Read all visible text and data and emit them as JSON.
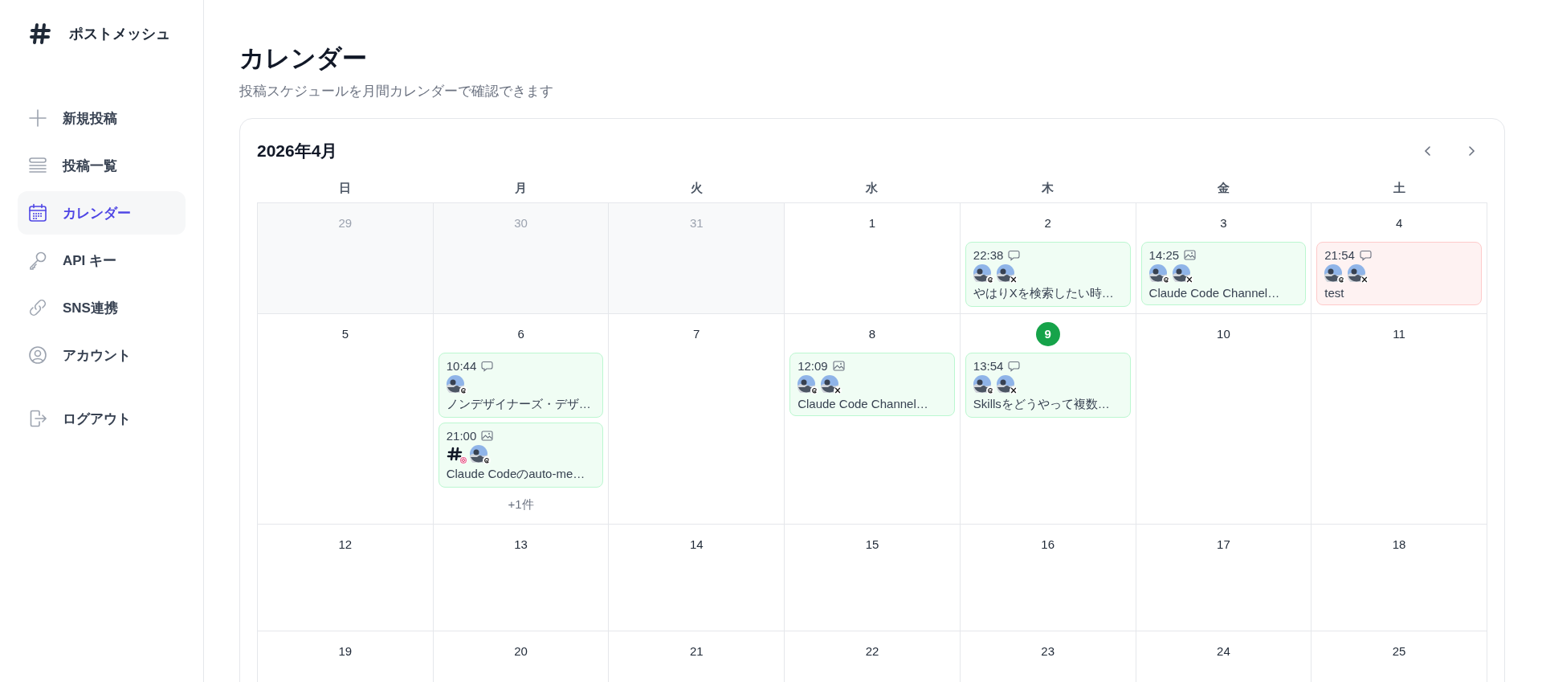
{
  "sidebar": {
    "brand": "ポストメッシュ",
    "items": [
      {
        "label": "新規投稿",
        "selected": false
      },
      {
        "label": "投稿一覧",
        "selected": false
      },
      {
        "label": "カレンダー",
        "selected": true
      },
      {
        "label": "API キー",
        "selected": false
      },
      {
        "label": "SNS連携",
        "selected": false
      },
      {
        "label": "アカウント",
        "selected": false
      }
    ],
    "logout": "ログアウト"
  },
  "page": {
    "title": "カレンダー",
    "subtitle": "投稿スケジュールを月間カレンダーで確認できます"
  },
  "calendar": {
    "month": "2026年4月",
    "weekdays": [
      "日",
      "月",
      "火",
      "水",
      "木",
      "金",
      "土"
    ],
    "weeks": [
      [
        {
          "day": "29",
          "muted": true,
          "today": false
        },
        {
          "day": "30",
          "muted": true,
          "today": false
        },
        {
          "day": "31",
          "muted": true,
          "today": false
        },
        {
          "day": "1",
          "muted": false,
          "today": false
        },
        {
          "day": "2",
          "muted": false,
          "today": false,
          "events": [
            {
              "time": "22:38",
              "kind": "text",
              "failed": false,
              "accounts": [
                {
                  "kind": "threads"
                },
                {
                  "kind": "x"
                }
              ],
              "text": "やはりXを検索したい時…"
            }
          ]
        },
        {
          "day": "3",
          "muted": false,
          "today": false,
          "events": [
            {
              "time": "14:25",
              "kind": "image",
              "failed": false,
              "accounts": [
                {
                  "kind": "threads"
                },
                {
                  "kind": "x"
                }
              ],
              "text": "Claude Code Channel…"
            }
          ]
        },
        {
          "day": "4",
          "muted": false,
          "today": false,
          "events": [
            {
              "time": "21:54",
              "kind": "text",
              "failed": true,
              "accounts": [
                {
                  "kind": "threads"
                },
                {
                  "kind": "x"
                }
              ],
              "text": "test"
            }
          ]
        }
      ],
      [
        {
          "day": "5",
          "muted": false,
          "today": false
        },
        {
          "day": "6",
          "muted": false,
          "today": false,
          "events": [
            {
              "time": "10:44",
              "kind": "text",
              "failed": false,
              "accounts": [
                {
                  "kind": "threads"
                }
              ],
              "text": "ノンデザイナーズ・デザ…"
            },
            {
              "time": "21:00",
              "kind": "image",
              "failed": false,
              "accounts": [
                {
                  "kind": "instagram"
                },
                {
                  "kind": "threads"
                }
              ],
              "text": "Claude Codeのauto-me…"
            }
          ],
          "more": "+1件"
        },
        {
          "day": "7",
          "muted": false,
          "today": false
        },
        {
          "day": "8",
          "muted": false,
          "today": false,
          "events": [
            {
              "time": "12:09",
              "kind": "image",
              "failed": false,
              "accounts": [
                {
                  "kind": "threads"
                },
                {
                  "kind": "x"
                }
              ],
              "text": "Claude Code Channel…"
            }
          ]
        },
        {
          "day": "9",
          "muted": false,
          "today": true,
          "events": [
            {
              "time": "13:54",
              "kind": "text",
              "failed": false,
              "accounts": [
                {
                  "kind": "threads"
                },
                {
                  "kind": "x"
                }
              ],
              "text": "Skillsをどうやって複数…"
            }
          ]
        },
        {
          "day": "10",
          "muted": false,
          "today": false
        },
        {
          "day": "11",
          "muted": false,
          "today": false
        }
      ],
      [
        {
          "day": "12",
          "muted": false,
          "today": false
        },
        {
          "day": "13",
          "muted": false,
          "today": false
        },
        {
          "day": "14",
          "muted": false,
          "today": false
        },
        {
          "day": "15",
          "muted": false,
          "today": false
        },
        {
          "day": "16",
          "muted": false,
          "today": false
        },
        {
          "day": "17",
          "muted": false,
          "today": false
        },
        {
          "day": "18",
          "muted": false,
          "today": false
        }
      ],
      [
        {
          "day": "19",
          "muted": false,
          "today": false
        },
        {
          "day": "20",
          "muted": false,
          "today": false
        },
        {
          "day": "21",
          "muted": false,
          "today": false
        },
        {
          "day": "22",
          "muted": false,
          "today": false
        },
        {
          "day": "23",
          "muted": false,
          "today": false
        },
        {
          "day": "24",
          "muted": false,
          "today": false
        },
        {
          "day": "25",
          "muted": false,
          "today": false
        }
      ]
    ]
  }
}
